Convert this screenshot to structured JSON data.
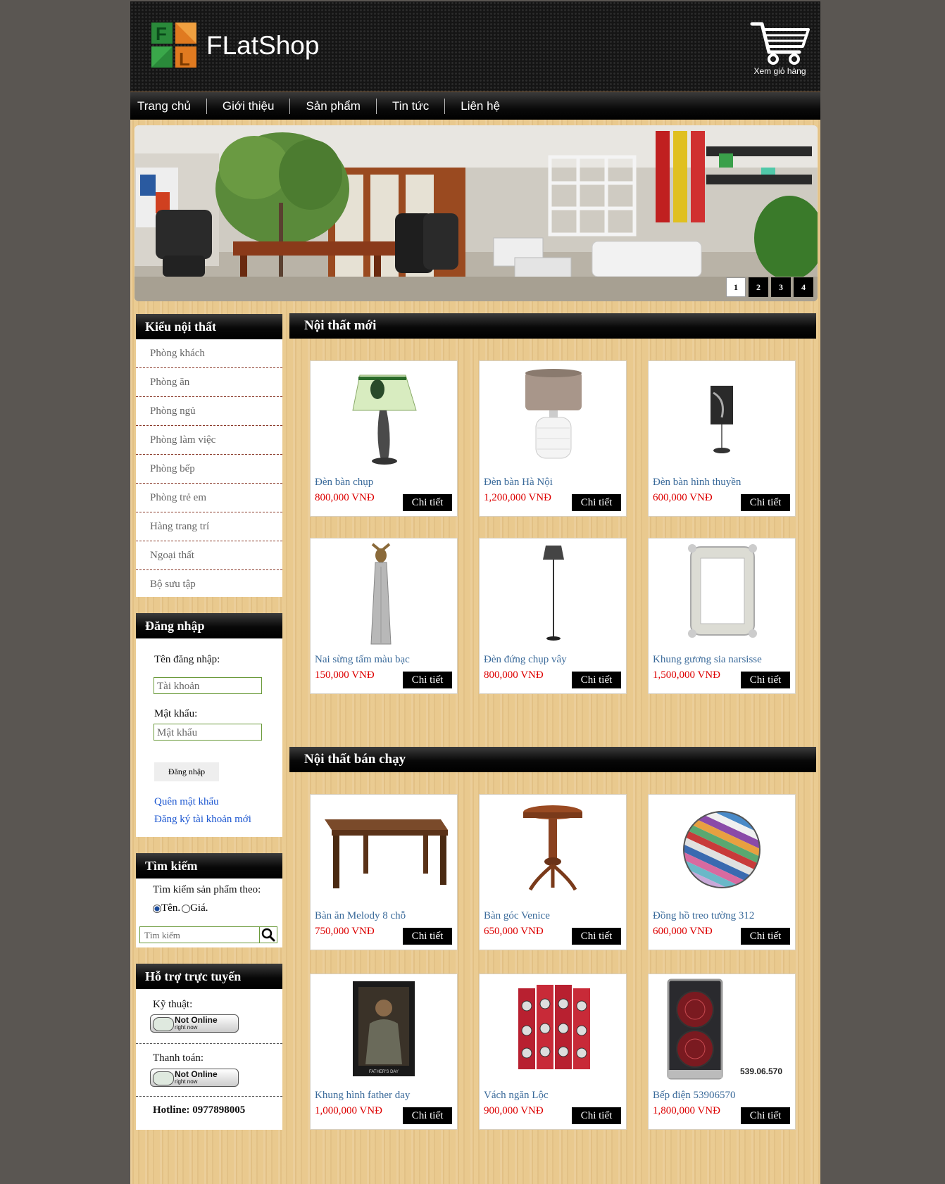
{
  "brand": {
    "name": "FLatShop",
    "cart_label": "Xem giỏ hàng"
  },
  "nav": [
    "Trang chủ",
    "Giới thiệu",
    "Sản phẩm",
    "Tin tức",
    "Liên hệ"
  ],
  "banner": {
    "slides": [
      "1",
      "2",
      "3",
      "4"
    ],
    "active_slide": 1
  },
  "categories": {
    "title": "Kiểu nội thất",
    "items": [
      "Phòng khách",
      "Phòng ăn",
      "Phòng ngủ",
      "Phòng làm việc",
      "Phòng bếp",
      "Phòng trẻ em",
      "Hàng trang trí",
      "Ngoại thất",
      "Bộ sưu tập"
    ]
  },
  "login": {
    "title": "Đăng nhập",
    "username_label": "Tên đăng nhập:",
    "username_placeholder": "Tài khoản",
    "password_label": "Mật khẩu:",
    "password_placeholder": "Mật khẩu",
    "submit": "Đăng nhập",
    "forgot": "Quên mật khẩu",
    "register": "Đăng ký tài khoản mới"
  },
  "search": {
    "title": "Tìm kiếm",
    "by_label": "Tìm kiếm sản phẩm theo:",
    "options": [
      "Tên.",
      "Giá."
    ],
    "selected": "Tên.",
    "placeholder": "Tìm kiếm"
  },
  "support": {
    "title": "Hỗ trợ trực tuyến",
    "technical_label": "Kỹ thuật:",
    "payment_label": "Thanh toán:",
    "status_big": "Not Online",
    "status_small": "right now",
    "hotline": "Hotline: 0977898005"
  },
  "new_products": {
    "title": "Nội thất mới",
    "items": [
      {
        "name": "Đèn bàn chụp",
        "price": "800,000 VNĐ",
        "button": "Chi tiết",
        "icon": "table-lamp-green-shade"
      },
      {
        "name": "Đèn bàn Hà Nội",
        "price": "1,200,000 VNĐ",
        "button": "Chi tiết",
        "icon": "table-lamp-drum-shade"
      },
      {
        "name": "Đèn bàn hình thuyền",
        "price": "600,000 VNĐ",
        "button": "Chi tiết",
        "icon": "table-lamp-black"
      },
      {
        "name": "Nai sừng tấm màu bạc",
        "price": "150,000 VNĐ",
        "button": "Chi tiết",
        "icon": "moose-statue"
      },
      {
        "name": "Đèn đứng chụp vây",
        "price": "800,000 VNĐ",
        "button": "Chi tiết",
        "icon": "floor-lamp"
      },
      {
        "name": "Khung gương sia narsisse",
        "price": "1,500,000 VNĐ",
        "button": "Chi tiết",
        "icon": "mirror-frame"
      }
    ]
  },
  "best_sellers": {
    "title": "Nội thất bán chạy",
    "items": [
      {
        "name": "Bàn ăn Melody 8 chỗ",
        "price": "750,000 VNĐ",
        "button": "Chi tiết",
        "icon": "dining-table"
      },
      {
        "name": "Bàn góc Venice",
        "price": "650,000 VNĐ",
        "button": "Chi tiết",
        "icon": "round-side-table"
      },
      {
        "name": "Đồng hồ treo tường 312",
        "price": "600,000 VNĐ",
        "button": "Chi tiết",
        "icon": "striped-wall-clock"
      },
      {
        "name": "Khung hình father day",
        "price": "1,000,000 VNĐ",
        "button": "Chi tiết",
        "icon": "portrait-frame",
        "caption": "FATHER'S DAY"
      },
      {
        "name": "Vách ngăn Lộc",
        "price": "900,000 VNĐ",
        "button": "Chi tiết",
        "icon": "folding-screen"
      },
      {
        "name": "Bếp điện 53906570",
        "price": "1,800,000 VNĐ",
        "button": "Chi tiết",
        "icon": "electric-hob",
        "caption": "539.06.570"
      }
    ]
  }
}
